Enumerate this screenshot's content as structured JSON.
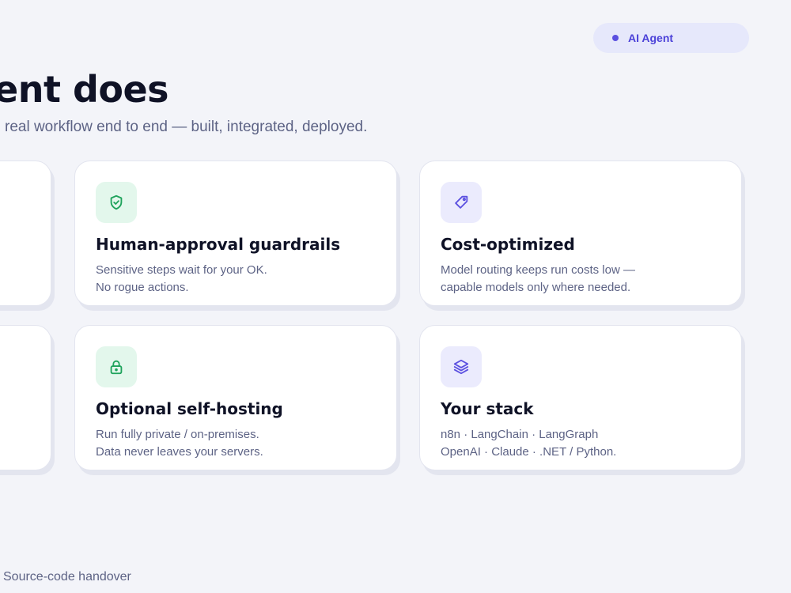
{
  "badge": {
    "label": "AI Agent"
  },
  "header": {
    "title": "ent does",
    "subtitle": "real workflow end to end — built, integrated, deployed."
  },
  "features": [
    {
      "icon": "shield-check-icon",
      "title": "Human-approval guardrails",
      "lines": [
        "Sensitive steps wait for your OK.",
        "No rogue actions."
      ]
    },
    {
      "icon": "tag-icon",
      "title": "Cost-optimized",
      "lines": [
        "Model routing keeps run costs low —",
        "capable models only where needed."
      ]
    },
    {
      "icon": "lock-icon",
      "title": "Optional self-hosting",
      "lines": [
        "Run fully private / on-premises.",
        "Data never leaves your servers."
      ]
    },
    {
      "icon": "layers-icon",
      "title": "Your stack",
      "lines": [
        "n8n · LangChain · LangGraph",
        "OpenAI · Claude · .NET / Python."
      ]
    }
  ],
  "footer": {
    "item": "Source-code handover"
  },
  "colors": {
    "background": "#f3f4f9",
    "accent": "#5b50e0",
    "green_icon": "#1fa35c",
    "green_tile": "#e3f7ec",
    "purple_tile": "#ebebfd",
    "text_muted": "#5d6385"
  }
}
